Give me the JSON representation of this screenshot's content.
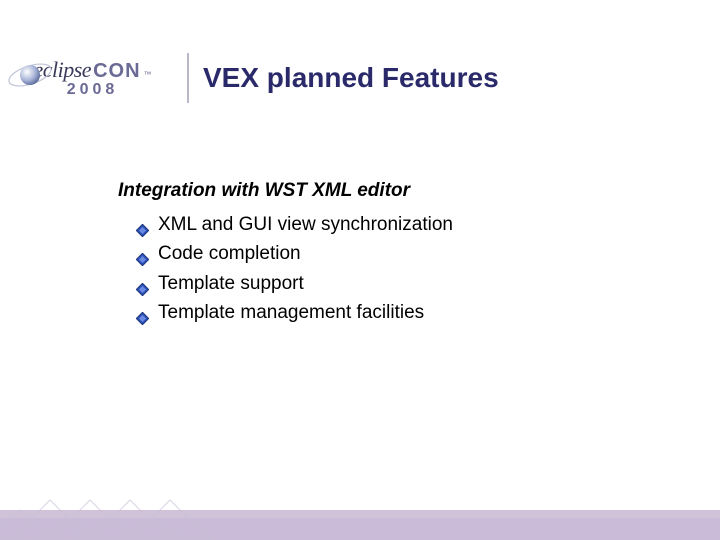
{
  "logo": {
    "text_eclipse": "eclipse",
    "text_con": "CON",
    "text_tm": "™",
    "year": "2008"
  },
  "title": "VEX planned Features",
  "subheading": "Integration with WST XML editor",
  "bullets": [
    "XML and GUI view synchronization",
    "Code completion",
    "Template support",
    "Template management facilities"
  ],
  "colors": {
    "title": "#2a2a6a",
    "logo_dark": "#3a3a5a",
    "logo_light": "#6a6a95",
    "bullet_fill": "#2b4fb8",
    "footer_band": "#8a6aa8"
  }
}
